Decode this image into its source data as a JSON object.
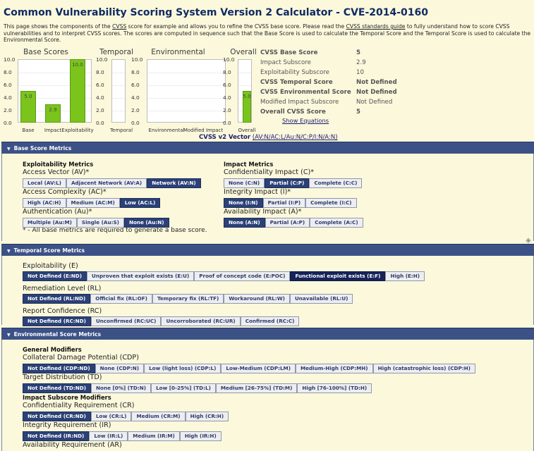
{
  "title": "Common Vulnerability Scoring System Version 2 Calculator - CVE-2014-0160",
  "intro": {
    "part1": "This page shows the components of the ",
    "link1": "CVSS",
    "part2": " score for example and allows you to refine the CVSS base score. Please read the ",
    "link2": "CVSS standards guide",
    "part3": " to fully understand how to score CVSS vulnerabilities and to interpret CVSS scores. The scores are computed in sequence such that the Base Score is used to calculate the Temporal Score and the Temporal Score is used to calculate the Environmental Score."
  },
  "chart_data": [
    {
      "type": "bar",
      "title": "Base Scores",
      "categories": [
        "Base",
        "Impact",
        "Exploitability"
      ],
      "values": [
        5.0,
        2.9,
        10.0
      ],
      "value_labels": [
        "5.0",
        "2.9",
        "10.0"
      ],
      "ylim": [
        0,
        10
      ],
      "yticks": [
        "10.0",
        "8.0",
        "6.0",
        "4.0",
        "2.0",
        "0.0"
      ],
      "bar_color": "#7ac41c"
    },
    {
      "type": "bar",
      "title": "Temporal",
      "categories": [
        "Temporal"
      ],
      "values": [],
      "ylim": [
        0,
        10
      ],
      "yticks": [
        "10.0",
        "8.0",
        "6.0",
        "4.0",
        "2.0",
        "0.0"
      ]
    },
    {
      "type": "bar",
      "title": "Environmental",
      "categories": [
        "Environmental",
        "Modified Impact"
      ],
      "values": [],
      "ylim": [
        0,
        10
      ],
      "yticks": [
        "10.0",
        "8.0",
        "6.0",
        "4.0",
        "2.0",
        "0.0"
      ]
    },
    {
      "type": "bar",
      "title": "Overall",
      "categories": [
        "Overall"
      ],
      "values": [
        5.0
      ],
      "value_labels": [
        "5.0"
      ],
      "ylim": [
        0,
        10
      ],
      "yticks": [
        "10.0",
        "8.0",
        "6.0",
        "4.0",
        "2.0",
        "0.0"
      ],
      "bar_color": "#7ac41c"
    }
  ],
  "vector": {
    "label": "CVSS v2 Vector",
    "value": "(AV:N/AC:L/Au:N/C:P/I:N/A:N)"
  },
  "scores": [
    {
      "label": "CVSS Base Score",
      "value": "5",
      "bold": true
    },
    {
      "label": "Impact Subscore",
      "value": "2.9",
      "bold": false
    },
    {
      "label": "Exploitability Subscore",
      "value": "10",
      "bold": false
    },
    {
      "label": "CVSS Temporal Score",
      "value": "Not Defined",
      "bold": true
    },
    {
      "label": "CVSS Environmental Score",
      "value": "Not Defined",
      "bold": true
    },
    {
      "label": "Modified Impact Subscore",
      "value": "Not Defined",
      "bold": false
    },
    {
      "label": "Overall CVSS Score",
      "value": "5",
      "bold": true
    }
  ],
  "show_equations": "Show Equations",
  "sections": {
    "base": "Base Score Metrics",
    "temporal": "Temporal Score Metrics",
    "environmental": "Environmental Score Metrics"
  },
  "base": {
    "exploitability_head": "Exploitability Metrics",
    "impact_head": "Impact Metrics",
    "note": "* - All base metrics are required to generate a base score.",
    "left": [
      {
        "label": "Access Vector (AV)*",
        "options": [
          "Local (AV:L)",
          "Adjacent Network (AV:A)",
          "Network (AV:N)"
        ],
        "selected": 2
      },
      {
        "label": "Access Complexity (AC)*",
        "options": [
          "High (AC:H)",
          "Medium (AC:M)",
          "Low (AC:L)"
        ],
        "selected": 2
      },
      {
        "label": "Authentication (Au)*",
        "options": [
          "Multiple (Au:M)",
          "Single (Au:S)",
          "None (Au:N)"
        ],
        "selected": 2
      }
    ],
    "right": [
      {
        "label": "Confidentiality Impact (C)*",
        "options": [
          "None (C:N)",
          "Partial (C:P)",
          "Complete (C:C)"
        ],
        "selected": 1
      },
      {
        "label": "Integrity Impact (I)*",
        "options": [
          "None (I:N)",
          "Partial (I:P)",
          "Complete (I:C)"
        ],
        "selected": 0
      },
      {
        "label": "Availability Impact (A)*",
        "options": [
          "None (A:N)",
          "Partial (A:P)",
          "Complete (A:C)"
        ],
        "selected": 0
      }
    ]
  },
  "temporal": [
    {
      "label": "Exploitability (E)",
      "options": [
        "Not Defined (E:ND)",
        "Unproven that exploit exists (E:U)",
        "Proof of concept code (E:POC)",
        "Functional exploit exists (E:F)",
        "High (E:H)"
      ],
      "selected": 0,
      "dark": 3
    },
    {
      "label": "Remediation Level (RL)",
      "options": [
        "Not Defined (RL:ND)",
        "Official fix (RL:OF)",
        "Temporary fix (RL:TF)",
        "Workaround (RL:W)",
        "Unavailable (RL:U)"
      ],
      "selected": 0
    },
    {
      "label": "Report Confidence (RC)",
      "options": [
        "Not Defined (RC:ND)",
        "Unconfirmed (RC:UC)",
        "Uncorroborated (RC:UR)",
        "Confirmed (RC:C)"
      ],
      "selected": 0
    }
  ],
  "environmental": {
    "general_head": "General Modifiers",
    "impact_head": "Impact Subscore Modifiers",
    "general": [
      {
        "label": "Collateral Damage Potential (CDP)",
        "options": [
          "Not Defined (CDP:ND)",
          "None (CDP:N)",
          "Low (light loss) (CDP:L)",
          "Low-Medium (CDP:LM)",
          "Medium-High (CDP:MH)",
          "High (catastrophic loss) (CDP:H)"
        ],
        "selected": 0
      },
      {
        "label": "Target Distribution (TD)",
        "options": [
          "Not Defined (TD:ND)",
          "None [0%] (TD:N)",
          "Low [0-25%] (TD:L)",
          "Medium [26-75%] (TD:M)",
          "High [76-100%] (TD:H)"
        ],
        "selected": 0
      }
    ],
    "impact": [
      {
        "label": "Confidentiality Requirement (CR)",
        "options": [
          "Not Defined (CR:ND)",
          "Low (CR:L)",
          "Medium (CR:M)",
          "High (CR:H)"
        ],
        "selected": 0
      },
      {
        "label": "Integrity Requirement (IR)",
        "options": [
          "Not Defined (IR:ND)",
          "Low (IR:L)",
          "Medium (IR:M)",
          "High (IR:H)"
        ],
        "selected": 0
      },
      {
        "label": "Availability Requirement (AR)",
        "options": [],
        "selected": 0
      }
    ]
  }
}
